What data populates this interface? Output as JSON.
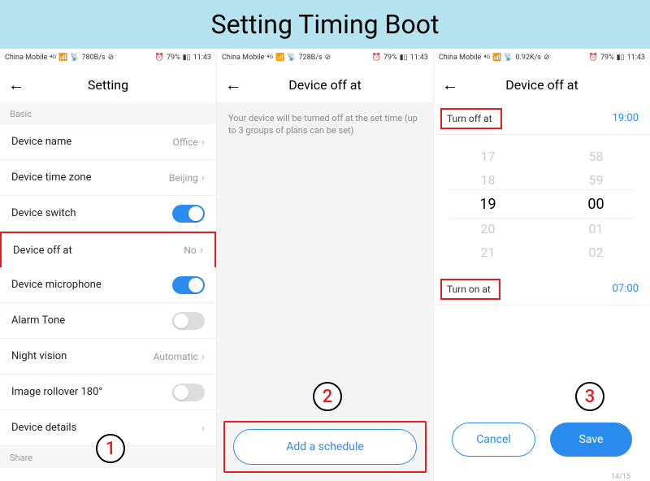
{
  "title": "Setting Timing Boot",
  "phones": {
    "p1": {
      "status": {
        "carrier": "China Mobile",
        "net": "780B/s",
        "battery": "79%",
        "time": "11:43"
      },
      "nav_title": "Setting",
      "sections": {
        "basic": "Basic",
        "share": "Share"
      },
      "rows": {
        "device_name": {
          "label": "Device name",
          "value": "Office"
        },
        "time_zone": {
          "label": "Device time zone",
          "value": "Beijing"
        },
        "device_switch": {
          "label": "Device switch",
          "on": true
        },
        "off_at": {
          "label": "Device off at",
          "value": "No"
        },
        "mic": {
          "label": "Device microphone",
          "on": true
        },
        "alarm": {
          "label": "Alarm Tone",
          "on": false
        },
        "night": {
          "label": "Night vision",
          "value": "Automatic"
        },
        "rollover": {
          "label": "Image rollover 180°",
          "on": false
        },
        "details": {
          "label": "Device details"
        }
      },
      "callout": "1"
    },
    "p2": {
      "status": {
        "carrier": "China Mobile",
        "net": "728B/s",
        "battery": "79%",
        "time": "11:43"
      },
      "nav_title": "Device off at",
      "hint": "Your device will be turned off at the set time (up to 3 groups of plans can be set)",
      "add_label": "Add a schedule",
      "callout": "2"
    },
    "p3": {
      "status": {
        "carrier": "China Mobile",
        "net": "0.92K/s",
        "battery": "79%",
        "time": "11:43"
      },
      "nav_title": "Device off at",
      "off": {
        "label": "Turn off at",
        "value": "19:00"
      },
      "on": {
        "label": "Turn on at",
        "value": "07:00"
      },
      "picker": {
        "hours": [
          "17",
          "18",
          "19",
          "20",
          "21"
        ],
        "mins": [
          "58",
          "59",
          "00",
          "01",
          "02"
        ]
      },
      "cancel": "Cancel",
      "save": "Save",
      "page": "14/15",
      "callout": "3"
    }
  }
}
